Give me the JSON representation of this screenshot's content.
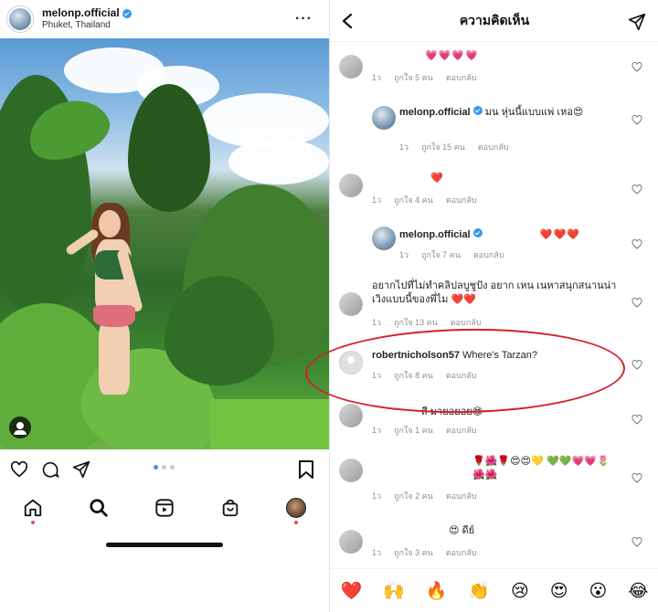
{
  "post": {
    "username": "melonp.official",
    "location": "Phuket, Thailand",
    "more_label": "···"
  },
  "comments_screen": {
    "title": "ความคิดเห็น",
    "comments": [
      {
        "id": "c1",
        "user": "",
        "text": "💗💗💗💗",
        "time": "1ว",
        "likes": "ถูกใจ 5 คน",
        "reply": "ตอบกลับ"
      },
      {
        "id": "c2",
        "user": "melonp.official",
        "text": "มน หุ่นนี้แบบแพ่ เหอ😍",
        "time": "1ว",
        "likes": "ถูกใจ 15 คน",
        "reply": "ตอบกลับ"
      },
      {
        "id": "c3",
        "user": "",
        "text": "❤️",
        "time": "1ว",
        "likes": "ถูกใจ 4 คน",
        "reply": "ตอบกลับ"
      },
      {
        "id": "c4",
        "user": "melonp.official",
        "text": "❤️❤️❤️",
        "time": "1ว",
        "likes": "ถูกใจ 7 คน",
        "reply": "ตอบกลับ"
      },
      {
        "id": "c5",
        "user": "",
        "text": "อยากไปที่ไม่ทำคลิปลบูชูปัง อยาก เหน เนหาสนุกสนานน่าเวิงแบบนี้ของพี่ไม ❤️❤️",
        "time": "1ว",
        "likes": "ถูกใจ 13 คน",
        "reply": "ตอบกลับ"
      },
      {
        "id": "c6",
        "user": "robertnicholson57",
        "text": "Where's Tarzan?",
        "time": "1ว",
        "likes": "ถูกใจ 8 คน",
        "reply": "ตอบกลับ"
      },
      {
        "id": "c7",
        "user": "",
        "text": "สี มายอยอย😍",
        "time": "1ว",
        "likes": "ถูกใจ 1 คน",
        "reply": "ตอบกลับ"
      },
      {
        "id": "c8",
        "user": "",
        "text": "🌹🌺🌹😍😍💛 💚💚💗💗🌷🌺🌺",
        "time": "1ว",
        "likes": "ถูกใจ 2 คน",
        "reply": "ตอบกลับ"
      },
      {
        "id": "c9",
        "user": "",
        "text": "😍 ดีย์",
        "time": "1ว",
        "likes": "ถูกใจ 3 คน",
        "reply": "ตอบกลับ"
      }
    ],
    "quick_emojis": [
      "❤️",
      "🙌",
      "🔥",
      "👏",
      "😢",
      "😍",
      "😮",
      "😂"
    ]
  },
  "colors": {
    "verified": "#3897f0",
    "annotation": "#d3202a",
    "notification": "#ed4956"
  },
  "icons": [
    "heart-icon",
    "comment-icon",
    "share-icon",
    "bookmark-icon",
    "home-icon",
    "search-icon",
    "reels-icon",
    "shop-icon",
    "back-icon",
    "send-icon",
    "tag-people-icon"
  ]
}
